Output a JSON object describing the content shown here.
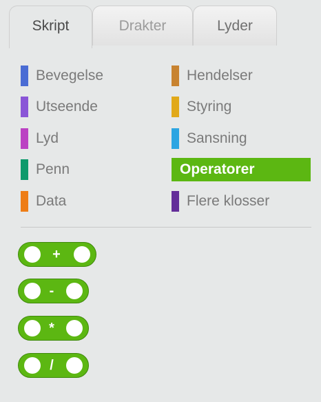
{
  "tabs": [
    {
      "label": "Skript"
    },
    {
      "label": "Drakter"
    },
    {
      "label": "Lyder"
    }
  ],
  "categories": {
    "left": [
      {
        "label": "Bevegelse",
        "color": "#4a6cd4"
      },
      {
        "label": "Utseende",
        "color": "#8a55d7"
      },
      {
        "label": "Lyd",
        "color": "#bb42c3"
      },
      {
        "label": "Penn",
        "color": "#0e9a6c"
      },
      {
        "label": "Data",
        "color": "#ee7d16"
      }
    ],
    "right": [
      {
        "label": "Hendelser",
        "color": "#c88330"
      },
      {
        "label": "Styring",
        "color": "#e1a91a"
      },
      {
        "label": "Sansning",
        "color": "#2ca5e2"
      },
      {
        "label": "Operatorer",
        "color": "#5cb712"
      },
      {
        "label": "Flere klosser",
        "color": "#632d99"
      }
    ],
    "selected": "Operatorer"
  },
  "blocks": [
    {
      "operator": "+"
    },
    {
      "operator": "-"
    },
    {
      "operator": "*"
    },
    {
      "operator": "/"
    }
  ]
}
